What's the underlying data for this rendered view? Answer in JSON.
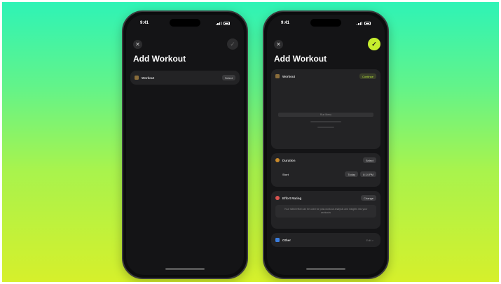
{
  "colors": {
    "accent": "#c6ee2e",
    "background_top": "#2ef3b6",
    "background_bottom": "#d6f02b",
    "screen": "#141416",
    "card": "#232325"
  },
  "left_phone": {
    "status": {
      "time": "9:41"
    },
    "icons": {
      "close": "close-icon",
      "done": "checkmark-icon"
    },
    "title": "Add Workout",
    "workout_row": {
      "label": "Workout",
      "action": "Select",
      "icon": "dumbbell-icon"
    }
  },
  "right_phone": {
    "status": {
      "time": "9:41"
    },
    "icons": {
      "close": "close-icon",
      "done": "checkmark-icon"
    },
    "title": "Add Workout",
    "workout_card": {
      "label": "Workout",
      "action": "Continue",
      "icon": "dumbbell-icon",
      "placeholder_title": "Run Menu"
    },
    "duration_card": {
      "label": "Duration",
      "action": "Select",
      "icon": "clock-icon",
      "sub_label": "Start",
      "date_pill": "Today",
      "time_pill": "8:14 PM"
    },
    "effort_card": {
      "label": "Effort Rating",
      "action": "Change",
      "icon": "heart-icon",
      "description": "Your rated effort can be used for post-workout analysis and insights into your workouts"
    },
    "other_row": {
      "label": "Other",
      "action": "Edit >",
      "icon": "chart-icon"
    }
  }
}
